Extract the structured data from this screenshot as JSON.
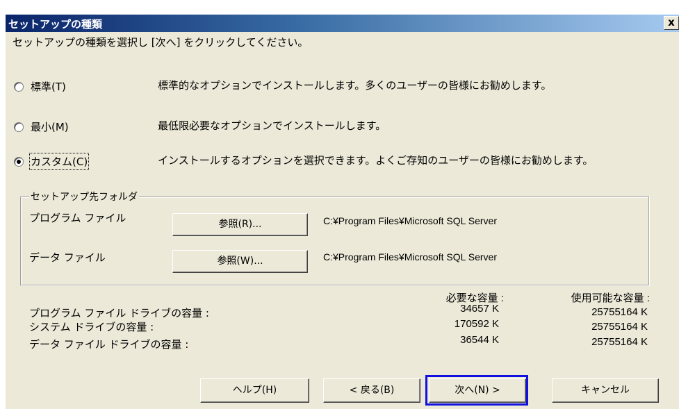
{
  "window": {
    "title": "セットアップの種類",
    "close_label": "x"
  },
  "instruction": "セットアップの種類を選択し [次へ] をクリックしてください。",
  "options": [
    {
      "label": "標準(T)",
      "description": "標準的なオプションでインストールします。多くのユーザーの皆様にお勧めします。",
      "checked": false
    },
    {
      "label": "最小(M)",
      "description": "最低限必要なオプションでインストールします。",
      "checked": false
    },
    {
      "label": "カスタム(C)",
      "description": "インストールするオプションを選択できます。よくご存知のユーザーの皆様にお勧めします。",
      "checked": true
    }
  ],
  "folder_group": {
    "title": "セットアップ先フォルダ",
    "rows": [
      {
        "label": "プログラム ファイル",
        "button": "参照(R)...",
        "path": "C:¥Program Files¥Microsoft SQL Server"
      },
      {
        "label": "データ ファイル",
        "button": "参照(W)...",
        "path": "C:¥Program Files¥Microsoft SQL Server"
      }
    ]
  },
  "space": {
    "required_header": "必要な容量 :",
    "available_header": "使用可能な容量 :",
    "rows": [
      {
        "label": "プログラム ファイル ドライブの容量 :",
        "required": "34657 K",
        "available": "25755164 K"
      },
      {
        "label": "システム ドライブの容量 :",
        "required": "170592 K",
        "available": "25755164 K"
      },
      {
        "label": "データ ファイル ドライブの容量 :",
        "required": "36544 K",
        "available": "25755164 K"
      }
    ]
  },
  "buttons": {
    "help": "ヘルプ(H)",
    "back": "< 戻る(B)",
    "next": "次へ(N) >",
    "cancel": "キャンセル"
  },
  "colors": {
    "titlebar_start": "#0a246a",
    "face": "#ece9d8",
    "highlight": "#1010e0"
  }
}
